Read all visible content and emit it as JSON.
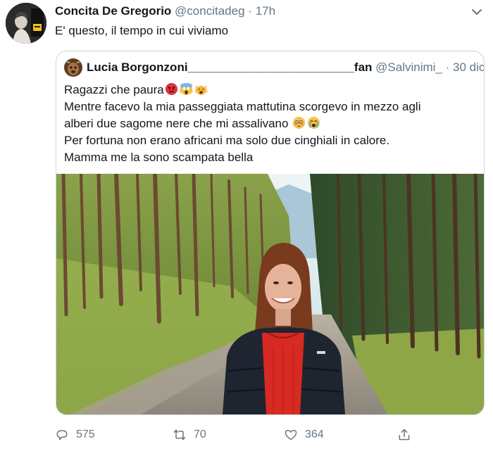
{
  "tweet": {
    "author_name": "Concita De Gregorio",
    "handle": "@concitadeg",
    "separator": "·",
    "time": "17h",
    "text": "E' questo, il tempo in cui viviamo",
    "avatar_icon": "profile-avatar",
    "more_icon": "chevron-down-icon"
  },
  "quoted": {
    "author_name": "Lucia Borgonzoni_________________________fan",
    "handle": "@Salvinimi_",
    "separator": "·",
    "time": "30 dic",
    "lines": [
      "Ragazzi che paura",
      "Mentre facevo la mia passeggiata mattutina  scorgevo in mezzo agli",
      "alberi due sagome nere che mi assalivano",
      "Per fortuna non erano africani ma solo due cinghiali in calore.",
      "Mamma me la sono scampata bella"
    ],
    "emojis_line1": [
      "angry-face-emoji",
      "screaming-face-emoji",
      "weary-cat-emoji"
    ],
    "emojis_line3": [
      "flushed-face-emoji",
      "crying-face-emoji"
    ],
    "photo": "woman-in-forest-photo"
  },
  "actions": {
    "reply_count": "575",
    "retweet_count": "70",
    "like_count": "364",
    "reply_icon": "reply-icon",
    "retweet_icon": "retweet-icon",
    "like_icon": "heart-icon",
    "share_icon": "share-icon"
  },
  "colors": {
    "text": "#14171a",
    "secondary": "#657786",
    "border": "#ccd6dd"
  }
}
